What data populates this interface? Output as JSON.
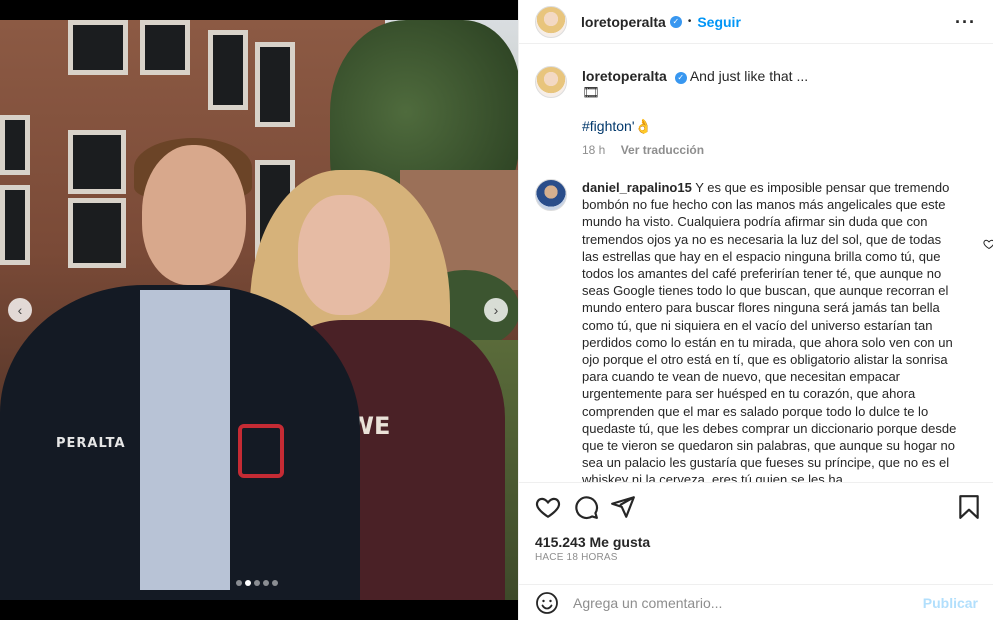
{
  "post": {
    "username": "loretoperalta",
    "follow_label": "Seguir",
    "more_icon": "more-horizontal-icon",
    "verified_icon": "verified-badge-icon",
    "caption_text": "And just like that ...",
    "caption_emoji": "🎞",
    "hashtag": "#fightonʹ👌",
    "caption_time": "18 h",
    "translate_label": "Ver traducción",
    "photo_tag_jacket": "PERALTA",
    "photo_sweater_text": "UWE",
    "nav_left_icon": "chevron-left-icon",
    "nav_right_icon": "chevron-right-icon",
    "carousel": {
      "count": 5,
      "active_index": 1
    }
  },
  "comment": {
    "username": "daniel_rapalino15",
    "text": "Y es que es imposible pensar que tremendo bombón no fue hecho con las manos más angelicales que este mundo ha visto. Cualquiera podría afirmar sin duda que con tremendos ojos ya no es necesaria la luz del sol, que de todas las estrellas que hay en el espacio ninguna brilla como tú, que todos los amantes del café preferirían tener té, que aunque no seas Google tienes todo lo que buscan, que aunque recorran el mundo entero para buscar flores ninguna será jamás tan bella como tú, que ni siquiera en el vacío del universo estarían tan perdidos como lo están en tu mirada, que ahora solo ven con un ojo porque el otro está en tí, que es obligatorio alistar la sonrisa para cuando te vean de nuevo, que necesitan empacar urgentemente para ser huésped en tu corazón, que ahora comprenden que el mar es salado porque todo lo dulce te lo quedaste tú, que les debes comprar un diccionario porque desde que te vieron se quedaron sin palabras, que aunque su hogar no sea un palacio les gustaría que fueses su príncipe, que no es el whiskey ni la cerveza, eres tú quien se les ha",
    "like_icon": "heart-outline-icon"
  },
  "actions": {
    "like_icon": "heart-icon",
    "comment_icon": "comment-icon",
    "share_icon": "send-icon",
    "save_icon": "bookmark-icon",
    "likes_text": "415.243 Me gusta",
    "time_text": "HACE 18 HORAS"
  },
  "composer": {
    "emoji_icon": "smile-icon",
    "placeholder": "Agrega un comentario...",
    "publish_label": "Publicar"
  },
  "colors": {
    "accent": "#0095f6",
    "publish_disabled": "#b2dffc",
    "verified": "#3897f0"
  }
}
